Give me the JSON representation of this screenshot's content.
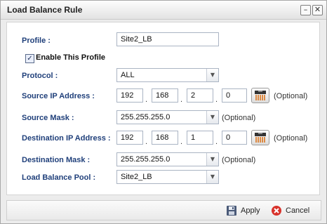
{
  "window": {
    "title": "Load Balance Rule",
    "minimize_icon": "minimize-icon",
    "close_icon": "close-icon"
  },
  "form": {
    "profile": {
      "label": "Profile :",
      "value": "Site2_LB"
    },
    "enable": {
      "label": "Enable This Profile",
      "checked": true
    },
    "protocol": {
      "label": "Protocol :",
      "value": "ALL"
    },
    "source_ip": {
      "label": "Source IP Address :",
      "octets": [
        "192",
        "168",
        "2",
        "0"
      ],
      "optional": "(Optional)"
    },
    "source_mask": {
      "label": "Source Mask :",
      "value": "255.255.255.0",
      "optional": "(Optional)"
    },
    "dest_ip": {
      "label": "Destination IP Address :",
      "octets": [
        "192",
        "168",
        "1",
        "0"
      ],
      "optional": "(Optional)"
    },
    "dest_mask": {
      "label": "Destination Mask :",
      "value": "255.255.255.0",
      "optional": "(Optional)"
    },
    "pool": {
      "label": "Load Balance Pool :",
      "value": "Site2_LB"
    },
    "dot": "."
  },
  "footer": {
    "apply_label": "Apply",
    "cancel_label": "Cancel"
  },
  "colors": {
    "label": "#1f3f7a",
    "accent": "#d9731c",
    "cancel_red": "#d8322b"
  }
}
